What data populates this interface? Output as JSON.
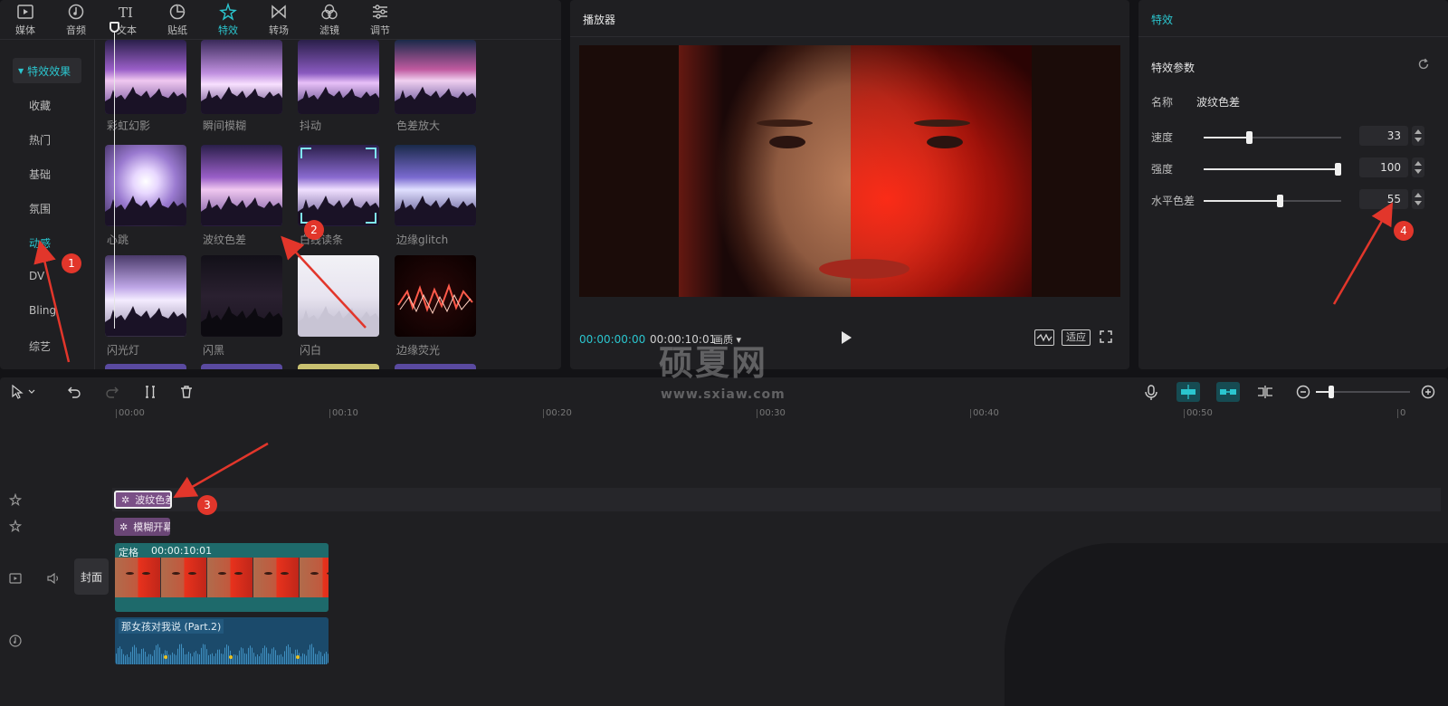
{
  "toolbar": {
    "tabs": [
      {
        "label": "媒体",
        "icon": "media-icon"
      },
      {
        "label": "音频",
        "icon": "audio-icon"
      },
      {
        "label": "文本",
        "icon": "text-icon"
      },
      {
        "label": "贴纸",
        "icon": "sticker-icon"
      },
      {
        "label": "特效",
        "icon": "effects-icon"
      },
      {
        "label": "转场",
        "icon": "transition-icon"
      },
      {
        "label": "滤镜",
        "icon": "filter-icon"
      },
      {
        "label": "调节",
        "icon": "adjust-icon"
      }
    ],
    "active": "特效"
  },
  "categories": {
    "header": "特效效果",
    "items": [
      "收藏",
      "热门",
      "基础",
      "氛围",
      "动感",
      "DV",
      "Bling",
      "综艺"
    ],
    "active": "动感"
  },
  "effects": {
    "items": [
      "彩虹幻影",
      "瞬间模糊",
      "抖动",
      "色差放大",
      "心跳",
      "波纹色差",
      "白线读条",
      "边缘glitch",
      "闪光灯",
      "闪黑",
      "闪白",
      "边缘荧光"
    ]
  },
  "player": {
    "title": "播放器",
    "current_time": "00:00:00:00",
    "total_time": "00:00:10:01",
    "quality_label": "画质",
    "fit_label": "适应"
  },
  "effect_panel": {
    "title": "特效",
    "params_title": "特效参数",
    "name_label": "名称",
    "name_value": "波纹色差",
    "params": [
      {
        "label": "速度",
        "value": "33",
        "level": 0.33
      },
      {
        "label": "强度",
        "value": "100",
        "level": 1.0
      },
      {
        "label": "水平色差",
        "value": "55",
        "level": 0.55
      }
    ]
  },
  "timeline": {
    "ticks": [
      "00:00",
      "00:10",
      "00:20",
      "00:30",
      "00:40",
      "00:50",
      "0"
    ],
    "fx_clips": [
      "波纹色差",
      "模糊开幕"
    ],
    "video_clip": {
      "label": "定格",
      "duration": "00:00:10:01"
    },
    "audio_clip": {
      "label": "那女孩对我说 (Part.2)"
    },
    "cover_label": "封面"
  },
  "annotations": [
    "1",
    "2",
    "3",
    "4"
  ],
  "watermark": {
    "text": "硕夏网",
    "url": "www.sxiaw.com"
  },
  "colors": {
    "accent": "#2bc6cf",
    "fx_clip": "#7a4f86",
    "video_clip": "#1e6a6b",
    "audio_clip": "#1b4a6b",
    "annotation": "#e2362b"
  }
}
